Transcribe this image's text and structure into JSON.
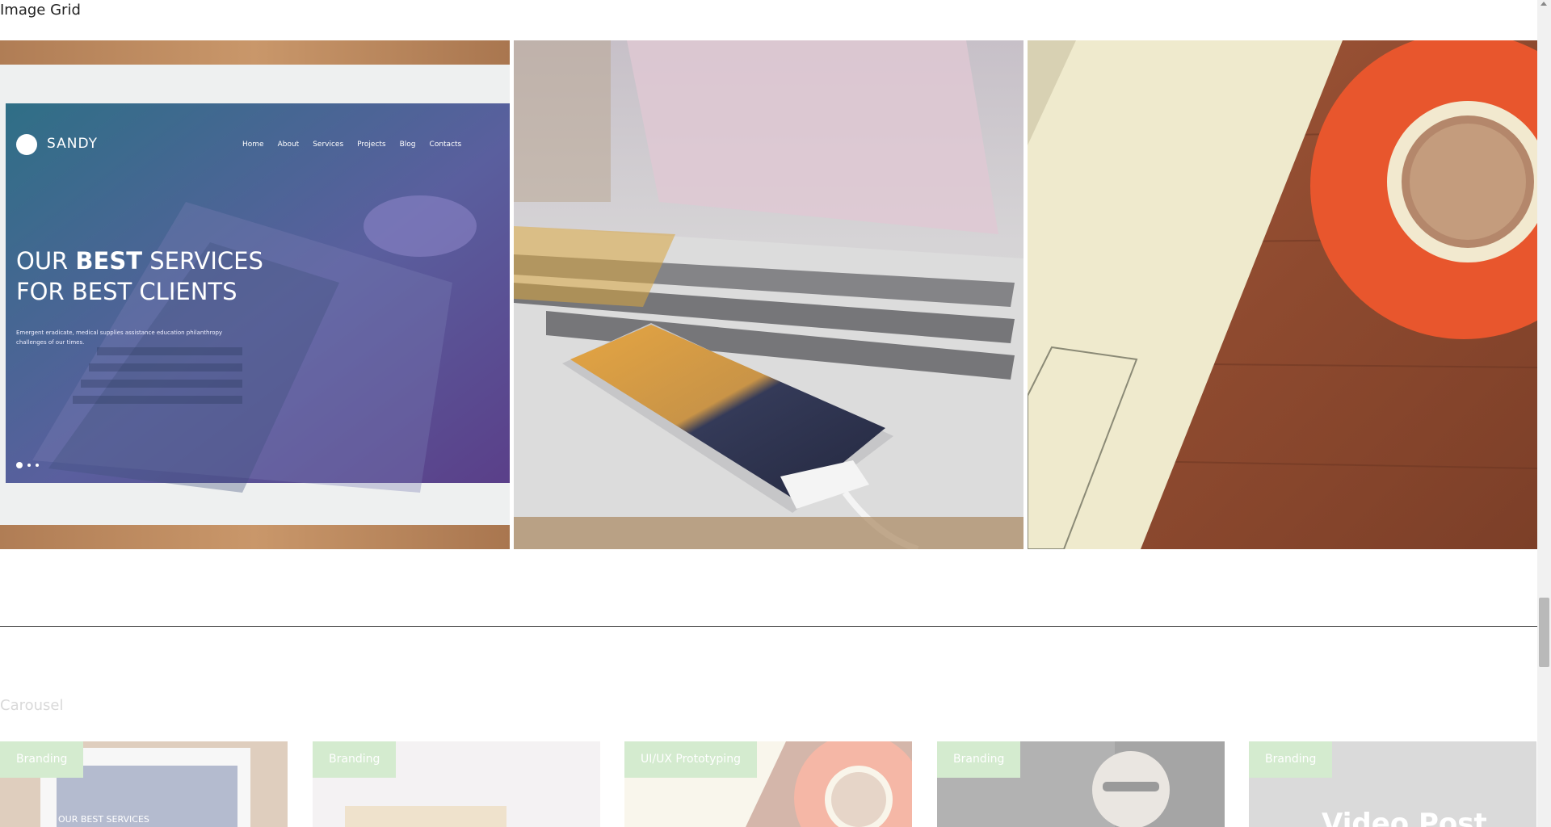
{
  "grid": {
    "title": "Image Grid",
    "tiles": [
      {
        "name": "sandy-website-tablet-photo",
        "brand": "SANDY",
        "nav": [
          "Home",
          "About",
          "Services",
          "Projects",
          "Blog",
          "Contacts"
        ],
        "headline_line1_prefix": "OUR ",
        "headline_line1_bold": "BEST",
        "headline_line1_suffix": " SERVICES",
        "headline_line2": "FOR BEST CLIENTS",
        "body_text_line1": "Emergent eradicate, medical supplies assistance education philanthropy",
        "body_text_line2": "challenges of our times."
      },
      {
        "name": "laptop-smartphone-photo"
      },
      {
        "name": "laptop-coffee-cup-photo"
      }
    ]
  },
  "carousel": {
    "title": "Carousel",
    "cards": [
      {
        "category": "Branding",
        "caption": "OUR BEST SERVICES"
      },
      {
        "category": "Branding"
      },
      {
        "category": "UI/UX Prototyping"
      },
      {
        "category": "Branding"
      },
      {
        "category": "Branding",
        "caption": "Video Post"
      }
    ]
  },
  "colors": {
    "badge": "#9ad08f",
    "divider": "#333333"
  }
}
